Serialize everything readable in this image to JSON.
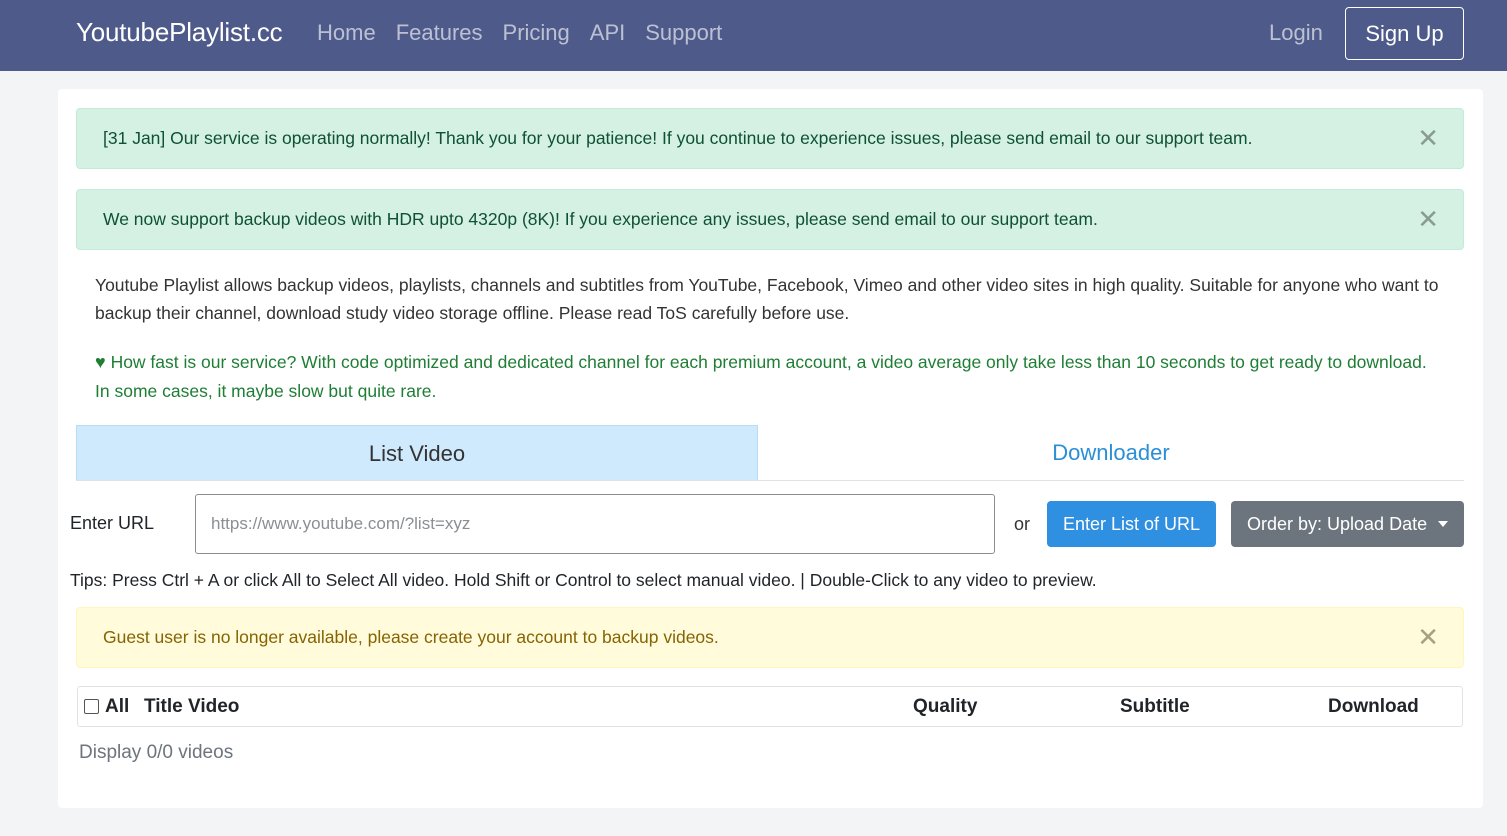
{
  "navbar": {
    "brand": "YoutubePlaylist.cc",
    "links": [
      "Home",
      "Features",
      "Pricing",
      "API",
      "Support"
    ],
    "login": "Login",
    "signup": "Sign Up"
  },
  "alerts": {
    "service": "[31 Jan] Our service is operating normally! Thank you for your patience! If you continue to experience issues, please send email to our support team.",
    "hdr": "We now support backup videos with HDR upto 4320p (8K)! If you experience any issues, please send email to our support team.",
    "guest": "Guest user is no longer available, please create your account to backup videos.",
    "close_symbol": "✕"
  },
  "intro": {
    "description": "Youtube Playlist allows backup videos, playlists, channels and subtitles from YouTube, Facebook, Vimeo and other video sites in high quality. Suitable for anyone who want to backup their channel, download study video storage offline. Please read ToS carefully before use.",
    "fast_icon": "heart-icon",
    "fast": "How fast is our service? With code optimized and dedicated channel for each premium account, a video average only take less than 10 seconds to get ready to download. In some cases, it maybe slow but quite rare."
  },
  "tabs": {
    "list_video": "List Video",
    "downloader": "Downloader"
  },
  "url_form": {
    "label": "Enter URL",
    "placeholder": "https://www.youtube.com/?list=xyz",
    "or": "or",
    "enter_list_button": "Enter List of URL",
    "order_button": "Order by: Upload Date"
  },
  "tips": "Tips: Press Ctrl + A or click All to Select All video. Hold Shift or Control to select manual video. | Double-Click to any video to preview.",
  "table": {
    "all": "All",
    "title": "Title Video",
    "quality": "Quality",
    "subtitle": "Subtitle",
    "download": "Download"
  },
  "display_count": "Display 0/0 videos",
  "colors": {
    "navbar": "#4e5b8a",
    "success_bg": "#d4f1e4",
    "warning_bg": "#fffbdb",
    "primary": "#2f8fe0",
    "secondary": "#6c757d",
    "tab_active": "#cfe9fd"
  }
}
